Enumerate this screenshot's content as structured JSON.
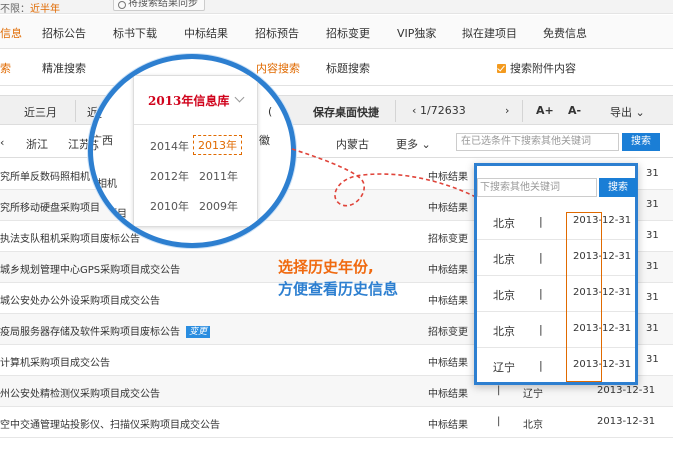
{
  "topstrip": {
    "left_prefix": "不限：",
    "left_value": "近半年",
    "sync_button": "将搜索结果同步"
  },
  "nav1": [
    "信息",
    "招标公告",
    "标书下载",
    "中标结果",
    "招标预告",
    "招标变更",
    "VIP独家",
    "拟在建项目",
    "免费信息"
  ],
  "nav2": {
    "items": [
      "索",
      "精准搜索",
      "内容搜索",
      "标题搜索"
    ],
    "attachment_search": "搜索附件内容"
  },
  "toolbar": {
    "range": "近三月",
    "partial": "近",
    "save_desktop": "保存桌面快捷",
    "page": "1/72633",
    "font_up": "A+",
    "font_down": "A-",
    "export": "导出"
  },
  "filters": {
    "regions": [
      "浙江",
      "江苏",
      "内蒙古"
    ],
    "more": "更多",
    "search_placeholder": "在已选条件下搜索其他关键词",
    "search_button": "搜索"
  },
  "rows": [
    {
      "title": "究所单反数码照相机",
      "type": "中标结果",
      "region": "",
      "date": "31",
      "badge": ""
    },
    {
      "title": "究所移动硬盘采购项目",
      "type": "中标结果",
      "region": "",
      "date": "31",
      "badge": ""
    },
    {
      "title": "执法支队租机采购项目废标公告",
      "type": "招标变更",
      "region": "",
      "date": "31",
      "badge": ""
    },
    {
      "title": "城乡规划管理中心GPS采购项目成交公告",
      "type": "中标结果",
      "region": "",
      "date": "31",
      "badge": ""
    },
    {
      "title": "城公安处办公外设采购项目成交公告",
      "type": "中标结果",
      "region": "",
      "date": "31",
      "badge": ""
    },
    {
      "title": "疫局服务器存储及软件采购项目废标公告",
      "type": "招标变更",
      "region": "",
      "date": "31",
      "badge": "变更"
    },
    {
      "title": "计算机采购项目成交公告",
      "type": "中标结果",
      "region": "",
      "date": "31",
      "badge": ""
    },
    {
      "title": "州公安处精检测仪采购项目成交公告",
      "type": "中标结果",
      "region": "辽宁",
      "date": "2013-12-31",
      "badge": ""
    },
    {
      "title": "空中交通管理站投影仪、扫描仪采购项目成交公告",
      "type": "中标结果",
      "region": "北京",
      "date": "2013-12-31",
      "badge": ""
    }
  ],
  "magnifier": {
    "dropdown_title": "2013年信息库",
    "years": [
      "2014年",
      "2013年",
      "2012年",
      "2011年",
      "2010年",
      "2009年"
    ],
    "selected_year": "2013年",
    "bg_left": "近",
    "bg_left2": "江苏",
    "bg_region": "广西",
    "bg_right": "徽",
    "bg_right2": "(",
    "bg_row1": "究所单反数码照相机",
    "bg_row2": "究所移动硬盘采购项目"
  },
  "zoom": {
    "placeholder": "下搜索其他关键词",
    "button": "搜索",
    "rows": [
      {
        "region": "北京",
        "bar": "|",
        "date": "2013-12-31"
      },
      {
        "region": "北京",
        "bar": "|",
        "date": "2013-12-31"
      },
      {
        "region": "北京",
        "bar": "|",
        "date": "2013-12-31"
      },
      {
        "region": "北京",
        "bar": "|",
        "date": "2013-12-31"
      },
      {
        "region": "辽宁",
        "bar": "|",
        "date": "2013-12-31"
      }
    ]
  },
  "caption": {
    "line1": "选择历史年份,",
    "line2": "方便查看历史信息"
  },
  "colors": {
    "accent_orange": "#e06a00",
    "brand_blue": "#2d7fd0",
    "dropdown_red": "#d0021b"
  }
}
